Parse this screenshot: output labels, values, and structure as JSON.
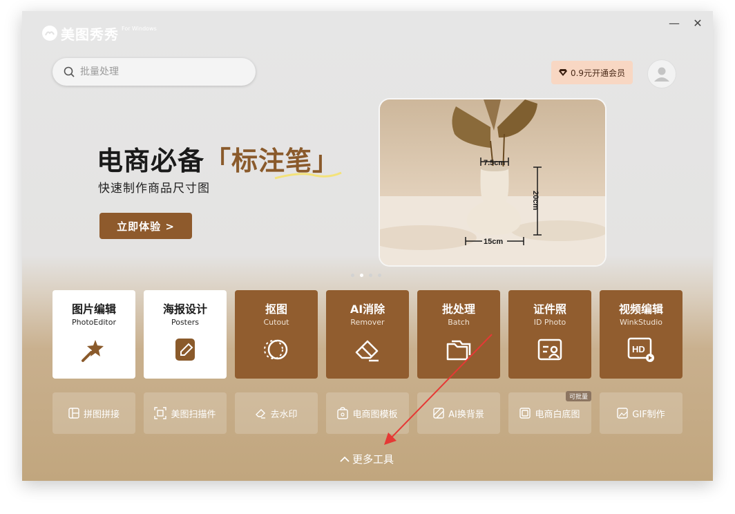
{
  "app": {
    "logo_text": "美图秀秀",
    "logo_sub": "For Windows",
    "minimize_glyph": "—",
    "close_glyph": "✕"
  },
  "search": {
    "placeholder": "批量处理"
  },
  "vip": {
    "label": "0.9元开通会员",
    "icon": "diamond-icon"
  },
  "banner": {
    "title_main": "电商必备",
    "title_accent": "「标注笔」",
    "subtitle": "快速制作商品尺寸图",
    "cta": "立即体验 >",
    "measure_top": "7.5cm",
    "measure_side": "20cm",
    "measure_bottom": "15cm",
    "carousel_active_index": 1,
    "carousel_count": 4
  },
  "cards": [
    {
      "title": "图片编辑",
      "sub": "PhotoEditor",
      "icon": "magic-wand-icon",
      "style": "white"
    },
    {
      "title": "海报设计",
      "sub": "Posters",
      "icon": "pen-square-icon",
      "style": "white"
    },
    {
      "title": "抠图",
      "sub": "Cutout",
      "icon": "cutout-circle-icon",
      "style": "brown"
    },
    {
      "title": "AI消除",
      "sub": "Remover",
      "icon": "eraser-icon",
      "style": "brown"
    },
    {
      "title": "批处理",
      "sub": "Batch",
      "icon": "folder-icon",
      "style": "brown"
    },
    {
      "title": "证件照",
      "sub": "ID Photo",
      "icon": "id-card-icon",
      "style": "brown"
    },
    {
      "title": "视频编辑",
      "sub": "WinkStudio",
      "icon": "hd-video-icon",
      "style": "brown"
    }
  ],
  "tools": [
    {
      "label": "拼图拼接",
      "icon": "collage-icon"
    },
    {
      "label": "美图扫描件",
      "icon": "scan-icon"
    },
    {
      "label": "去水印",
      "icon": "eraser-icon"
    },
    {
      "label": "电商图模板",
      "icon": "bag-template-icon"
    },
    {
      "label": "AI换背景",
      "icon": "background-icon"
    },
    {
      "label": "电商白底图",
      "icon": "white-bg-icon",
      "badge": "可批量"
    },
    {
      "label": "GIF制作",
      "icon": "gif-icon"
    }
  ],
  "more_tools": "更多工具",
  "colors": {
    "brand_brown": "#915d2f",
    "accent_text": "#8a5a2b",
    "vip_bg": "#f8d7c3",
    "annotation_arrow": "#e53935"
  }
}
